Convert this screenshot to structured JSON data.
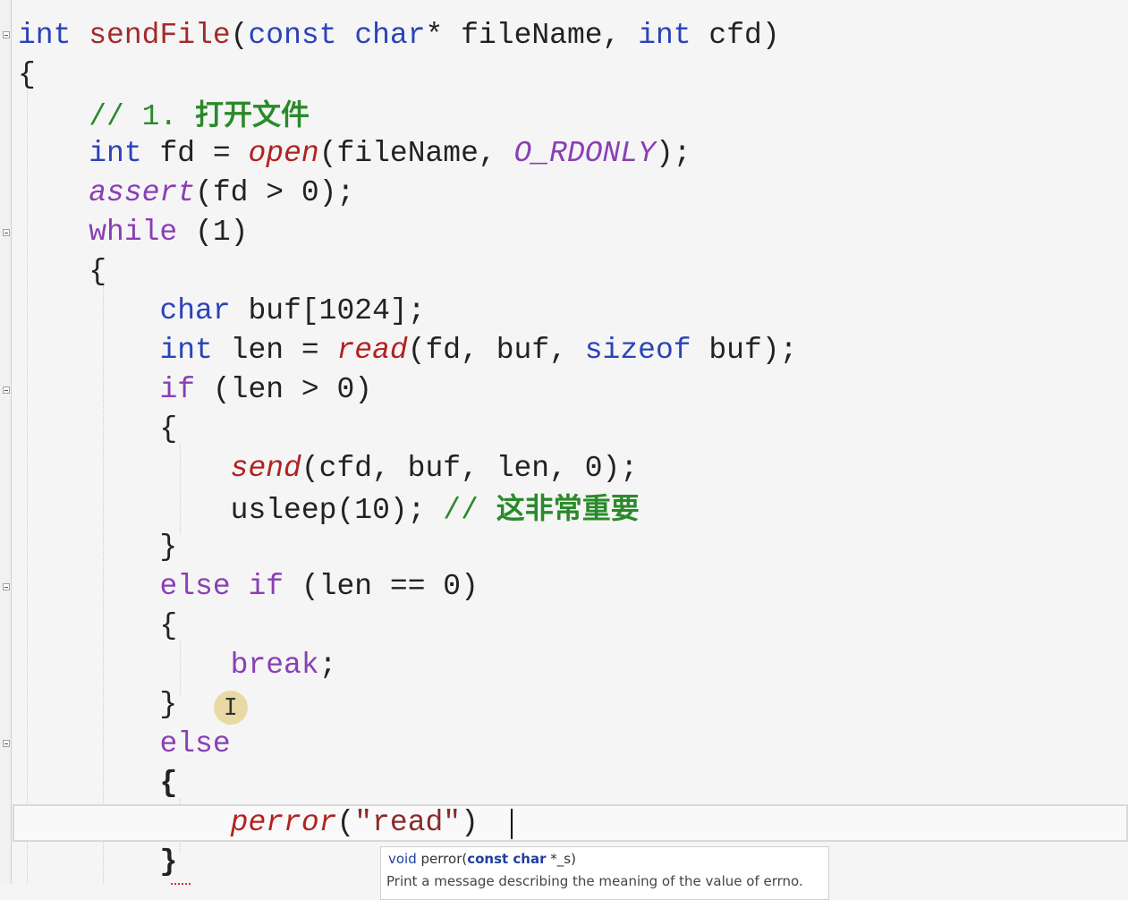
{
  "editor": {
    "lines": [
      {
        "tokens": [
          [
            "int",
            "kw"
          ],
          [
            " "
          ],
          [
            "sendFile",
            "fn-def"
          ],
          [
            "("
          ],
          [
            "const",
            "kw"
          ],
          [
            " "
          ],
          [
            "char",
            "kw"
          ],
          [
            "* fileName, "
          ],
          [
            "int",
            "kw"
          ],
          [
            " cfd)"
          ]
        ]
      },
      {
        "tokens": [
          [
            "{"
          ]
        ]
      },
      {
        "tokens": [
          [
            "    "
          ],
          [
            "// 1. ",
            "cmt"
          ],
          [
            "打开文件",
            "cmt cjk"
          ]
        ]
      },
      {
        "tokens": [
          [
            "    "
          ],
          [
            "int",
            "kw"
          ],
          [
            " fd = "
          ],
          [
            "open",
            "fn-red"
          ],
          [
            "(fileName, "
          ],
          [
            "O_RDONLY",
            "macro"
          ],
          [
            ");"
          ]
        ]
      },
      {
        "tokens": [
          [
            "    "
          ],
          [
            "assert",
            "macro"
          ],
          [
            "(fd > 0);"
          ]
        ]
      },
      {
        "tokens": [
          [
            "    "
          ],
          [
            "while",
            "kw2"
          ],
          [
            " (1)"
          ]
        ]
      },
      {
        "tokens": [
          [
            "    {"
          ]
        ]
      },
      {
        "tokens": [
          [
            "        "
          ],
          [
            "char",
            "kw"
          ],
          [
            " buf[1024];"
          ]
        ]
      },
      {
        "tokens": [
          [
            "        "
          ],
          [
            "int",
            "kw"
          ],
          [
            " len = "
          ],
          [
            "read",
            "fn-red"
          ],
          [
            "(fd, buf, "
          ],
          [
            "sizeof",
            "kw"
          ],
          [
            " buf);"
          ]
        ]
      },
      {
        "tokens": [
          [
            "        "
          ],
          [
            "if",
            "kw2"
          ],
          [
            " (len > 0)"
          ]
        ]
      },
      {
        "tokens": [
          [
            "        {"
          ]
        ]
      },
      {
        "tokens": [
          [
            "            "
          ],
          [
            "send",
            "fn-red"
          ],
          [
            "(cfd, buf, len, 0);"
          ]
        ]
      },
      {
        "tokens": [
          [
            "            usleep(10); "
          ],
          [
            "// ",
            "cmt"
          ],
          [
            "这非常重要",
            "cmt cjk"
          ]
        ]
      },
      {
        "tokens": [
          [
            "        }"
          ]
        ]
      },
      {
        "tokens": [
          [
            "        "
          ],
          [
            "else",
            "kw2"
          ],
          [
            " "
          ],
          [
            "if",
            "kw2"
          ],
          [
            " (len == 0)"
          ]
        ]
      },
      {
        "tokens": [
          [
            "        {"
          ]
        ]
      },
      {
        "tokens": [
          [
            "            "
          ],
          [
            "break",
            "kw2"
          ],
          [
            ";"
          ]
        ]
      },
      {
        "tokens": [
          [
            "        }"
          ]
        ]
      },
      {
        "tokens": [
          [
            "        "
          ],
          [
            "else",
            "kw2"
          ]
        ]
      },
      {
        "tokens": [
          [
            "        "
          ],
          [
            "{",
            "brace-bold"
          ]
        ]
      },
      {
        "tokens": [
          [
            "            "
          ],
          [
            "perror",
            "fn-red"
          ],
          [
            "("
          ],
          [
            "\"read\"",
            "str"
          ],
          [
            ")"
          ]
        ]
      },
      {
        "tokens": [
          [
            "        "
          ],
          [
            "}",
            "brace-bold"
          ]
        ]
      }
    ]
  },
  "tooltip": {
    "return_type": "void",
    "func_name": "perror(",
    "param_type": "const char",
    "param_rest": " *_s)",
    "description": "Print a message describing the meaning of the value of errno."
  },
  "colors": {
    "keyword": "#2b43b8",
    "control_keyword": "#8a3fb5",
    "function_call": "#b22222",
    "comment": "#2a8a2a",
    "string": "#8b2a2a"
  }
}
